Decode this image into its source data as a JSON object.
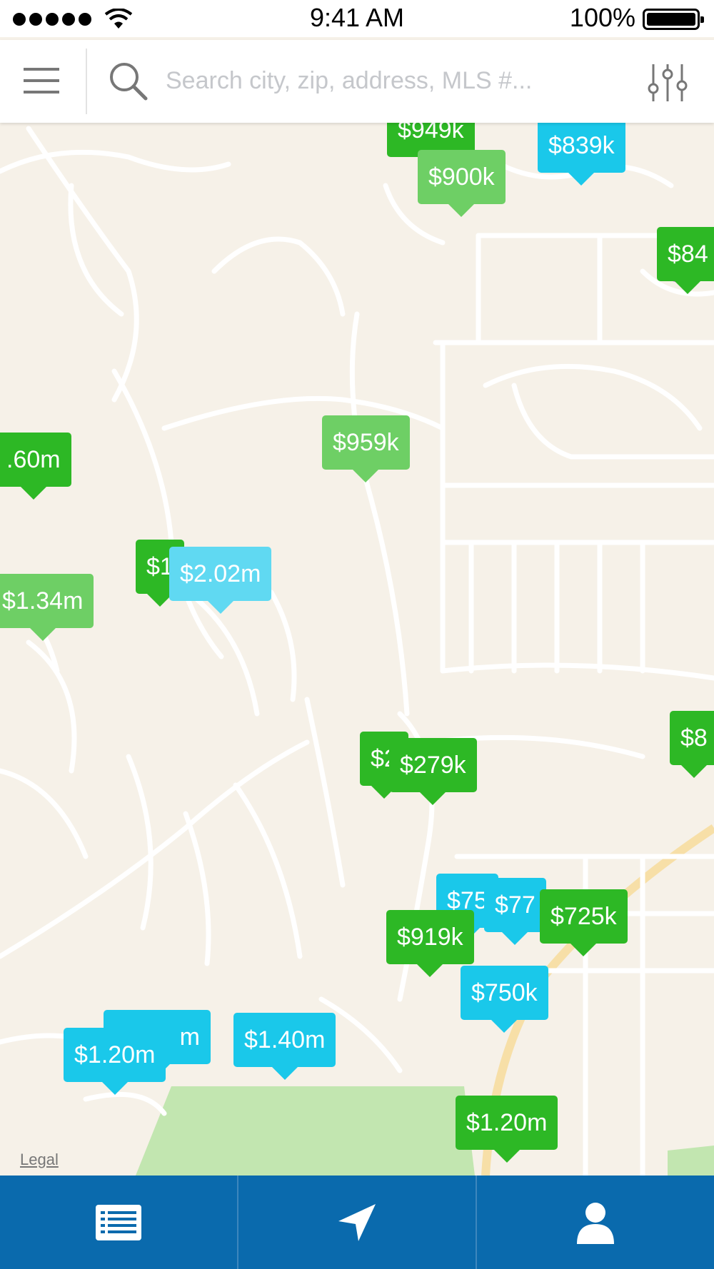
{
  "status_bar": {
    "time": "9:41 AM",
    "battery_percent": "100%",
    "signal_bars": 5
  },
  "search": {
    "placeholder": "Search city, zip, address, MLS #..."
  },
  "map": {
    "legal_label": "Legal",
    "markers": [
      {
        "price": "$949k",
        "color": "#2db825"
      },
      {
        "price": "$839k",
        "color": "#1ac8ea"
      },
      {
        "price": "$900k",
        "color": "#6ecf65"
      },
      {
        "price": "$84",
        "color": "#2db825"
      },
      {
        "price": "$959k",
        "color": "#6ecf65"
      },
      {
        "price": ".60m",
        "color": "#2db825"
      },
      {
        "price": "$1",
        "color": "#2db825"
      },
      {
        "price": "$2.02m",
        "color": "#60d9f2"
      },
      {
        "price": "$1.34m",
        "color": "#6ecf65"
      },
      {
        "price": "$8",
        "color": "#2db825"
      },
      {
        "price": "$2",
        "color": "#2db825"
      },
      {
        "price": "$279k",
        "color": "#2db825"
      },
      {
        "price": "$75",
        "color": "#1ac8ea"
      },
      {
        "price": "$77",
        "color": "#1ac8ea"
      },
      {
        "price": "$725k",
        "color": "#2db825"
      },
      {
        "price": "$919k",
        "color": "#2db825"
      },
      {
        "price": "$750k",
        "color": "#1ac8ea"
      },
      {
        "price": "m",
        "color": "#1ac8ea"
      },
      {
        "price": "$1.20m",
        "color": "#1ac8ea"
      },
      {
        "price": "$1.40m",
        "color": "#1ac8ea"
      },
      {
        "price": "$1.20m",
        "color": "#2db825"
      }
    ],
    "icons": [
      "video-camera-icon"
    ]
  },
  "tab_bar": {
    "tabs": [
      {
        "icon": "list-icon"
      },
      {
        "icon": "location-arrow-icon"
      },
      {
        "icon": "user-icon"
      }
    ],
    "background": "#0a6aad"
  },
  "colors": {
    "marker_dark_green": "#2db825",
    "marker_light_green": "#6ecf65",
    "marker_blue": "#1ac8ea",
    "marker_light_blue": "#60d9f2",
    "map_background": "#f6f1e8",
    "park": "#c2e6b0"
  }
}
